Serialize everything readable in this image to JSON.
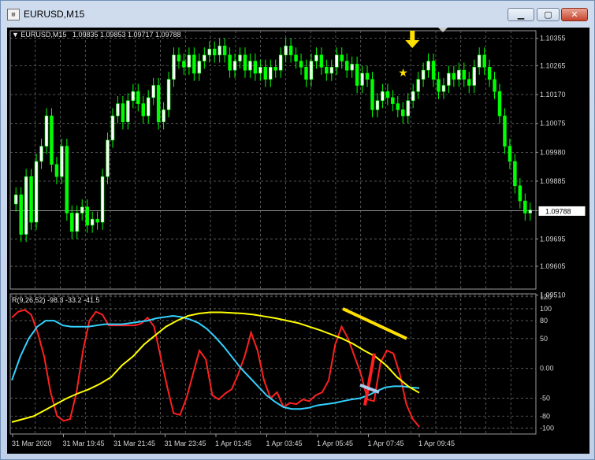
{
  "window": {
    "title": "EURUSD,M15",
    "buttons": [
      "minimize",
      "maximize",
      "close"
    ]
  },
  "chart_data": [
    {
      "type": "candlestick",
      "title": "EURUSD,M15",
      "ohlc_header": "1.09835 1.09853 1.09717 1.09788",
      "current_price": "1.09788",
      "ylim": [
        1.0953,
        1.1038
      ],
      "y_ticks": [
        "1.10355",
        "1.10265",
        "1.10170",
        "1.10075",
        "1.09980",
        "1.09885",
        "1.09788",
        "1.09695",
        "1.09605",
        "1.09510"
      ],
      "x_ticks": [
        "31 Mar 2020",
        "31 Mar 19:45",
        "31 Mar 21:45",
        "31 Mar 23:45",
        "1 Apr 01:45",
        "1 Apr 03:45",
        "1 Apr 05:45",
        "1 Apr 07:45",
        "1 Apr 09:45"
      ],
      "colors": {
        "up": "#ffffff",
        "down": "#00ff00",
        "wick": "#00ff00",
        "grid": "#6a6a6a",
        "background": "#000000"
      },
      "candles_close": [
        1.0984,
        1.0971,
        1.099,
        1.0975,
        1.0995,
        1.1,
        1.101,
        1.0994,
        1.099,
        1.1,
        1.0978,
        1.0972,
        1.0978,
        1.098,
        1.0974,
        1.0976,
        1.0975,
        1.099,
        1.1002,
        1.101,
        1.1014,
        1.1008,
        1.1015,
        1.1018,
        1.1014,
        1.101,
        1.1016,
        1.102,
        1.1008,
        1.1012,
        1.1022,
        1.103,
        1.1028,
        1.1026,
        1.103,
        1.1024,
        1.1028,
        1.103,
        1.1032,
        1.103,
        1.1033,
        1.103,
        1.1025,
        1.1028,
        1.103,
        1.1025,
        1.1028,
        1.1024,
        1.1026,
        1.1022,
        1.1026,
        1.1025,
        1.103,
        1.1033,
        1.103,
        1.1028,
        1.1026,
        1.1022,
        1.1028,
        1.103,
        1.1026,
        1.1024,
        1.1026,
        1.103,
        1.1028,
        1.1025,
        1.1027,
        1.102,
        1.1024,
        1.1022,
        1.1012,
        1.1015,
        1.1018,
        1.1016,
        1.1014,
        1.1012,
        1.101,
        1.1015,
        1.1018,
        1.1022,
        1.1025,
        1.1028,
        1.1022,
        1.1018,
        1.102,
        1.1024,
        1.1022,
        1.1025,
        1.1022,
        1.102,
        1.1026,
        1.103,
        1.1026,
        1.1022,
        1.1018,
        1.101,
        1.1,
        1.0995,
        1.0987,
        1.0982,
        1.0978,
        1.0979
      ],
      "annotations": {
        "arrow": "down-arrow-yellow",
        "star": "star-yellow"
      }
    },
    {
      "type": "line",
      "title": "R(9,26,52) -98.3 -33.2 -41.5",
      "ylim": [
        -110,
        125
      ],
      "y_ticks": [
        "120",
        "100",
        "80",
        "50",
        "0.00",
        "-50",
        "-80",
        "-100"
      ],
      "series": [
        {
          "color": "#ff2020",
          "values": [
            85,
            95,
            98,
            90,
            60,
            20,
            -40,
            -80,
            -88,
            -85,
            -40,
            30,
            80,
            95,
            90,
            72,
            72,
            72,
            72,
            72,
            75,
            85,
            70,
            20,
            -30,
            -75,
            -78,
            -50,
            -10,
            30,
            15,
            -45,
            -52,
            -42,
            -35,
            -10,
            20,
            60,
            30,
            -20,
            -50,
            -40,
            -65,
            -58,
            -60,
            -52,
            -55,
            -45,
            -40,
            -20,
            40,
            70,
            50,
            20,
            -10,
            -52,
            -55,
            10,
            30,
            25,
            -10,
            -60,
            -85,
            -98
          ]
        },
        {
          "color": "#33d1ff",
          "values": [
            -20,
            20,
            50,
            70,
            80,
            80,
            72,
            70,
            70,
            70,
            72,
            74,
            74,
            74,
            76,
            78,
            80,
            84,
            86,
            88,
            86,
            82,
            76,
            66,
            52,
            36,
            18,
            0,
            -15,
            -30,
            -45,
            -56,
            -65,
            -68,
            -68,
            -66,
            -62,
            -60,
            -58,
            -55,
            -52,
            -50,
            -45,
            -38,
            -32,
            -30,
            -30,
            -32,
            -33
          ]
        },
        {
          "color": "#ffff00",
          "values": [
            -90,
            -85,
            -80,
            -70,
            -60,
            -50,
            -42,
            -35,
            -26,
            -15,
            5,
            20,
            40,
            55,
            70,
            80,
            88,
            92,
            94,
            94,
            93,
            92,
            90,
            87,
            84,
            80,
            76,
            70,
            64,
            57,
            50,
            41,
            30,
            20,
            5,
            -15,
            -30,
            -41
          ]
        }
      ],
      "annotations": [
        "yellow-trend-line",
        "red-line",
        "light-blue-line"
      ]
    }
  ]
}
